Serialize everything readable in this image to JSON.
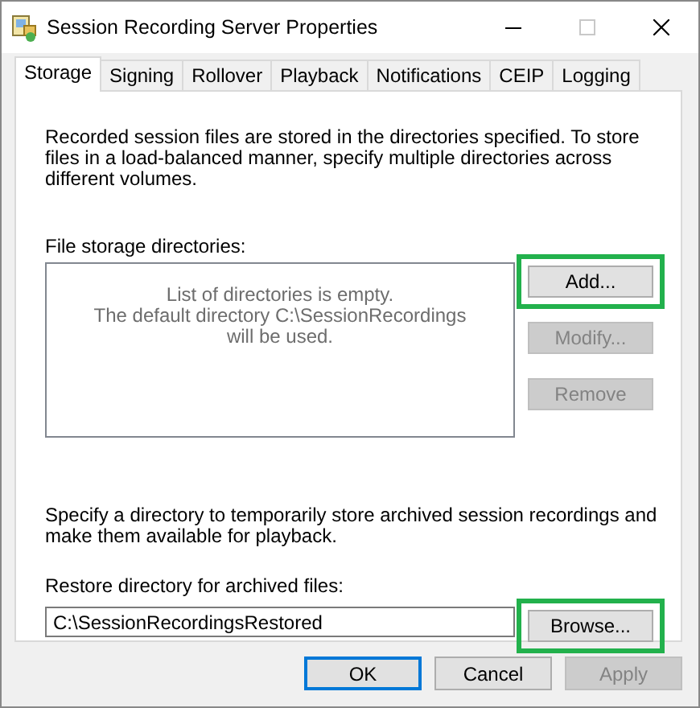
{
  "window": {
    "title": "Session Recording Server Properties"
  },
  "tabs": [
    {
      "label": "Storage",
      "selected": true
    },
    {
      "label": "Signing",
      "selected": false
    },
    {
      "label": "Rollover",
      "selected": false
    },
    {
      "label": "Playback",
      "selected": false
    },
    {
      "label": "Notifications",
      "selected": false
    },
    {
      "label": "CEIP",
      "selected": false
    },
    {
      "label": "Logging",
      "selected": false
    }
  ],
  "storage": {
    "intro": "Recorded session files are stored in the directories specified. To store files in a load-balanced manner, specify multiple directories across different volumes.",
    "list_label": "File storage directories:",
    "empty_message": "List of directories is empty.\nThe default directory C:\\SessionRecordings will be used.",
    "buttons": [
      {
        "label": "Add...",
        "disabled": false,
        "highlighted": true
      },
      {
        "label": "Modify...",
        "disabled": true,
        "highlighted": false
      },
      {
        "label": "Remove",
        "disabled": true,
        "highlighted": false
      }
    ]
  },
  "restore": {
    "intro": "Specify a directory to temporarily store archived session recordings and make them available for playback.",
    "label": "Restore directory for archived files:",
    "value": "C:\\SessionRecordingsRestored",
    "button": {
      "label": "Browse...",
      "disabled": false,
      "highlighted": true
    }
  },
  "footer_buttons": [
    {
      "label": "OK",
      "default": true,
      "disabled": false
    },
    {
      "label": "Cancel",
      "default": false,
      "disabled": false
    },
    {
      "label": "Apply",
      "default": false,
      "disabled": true
    }
  ]
}
